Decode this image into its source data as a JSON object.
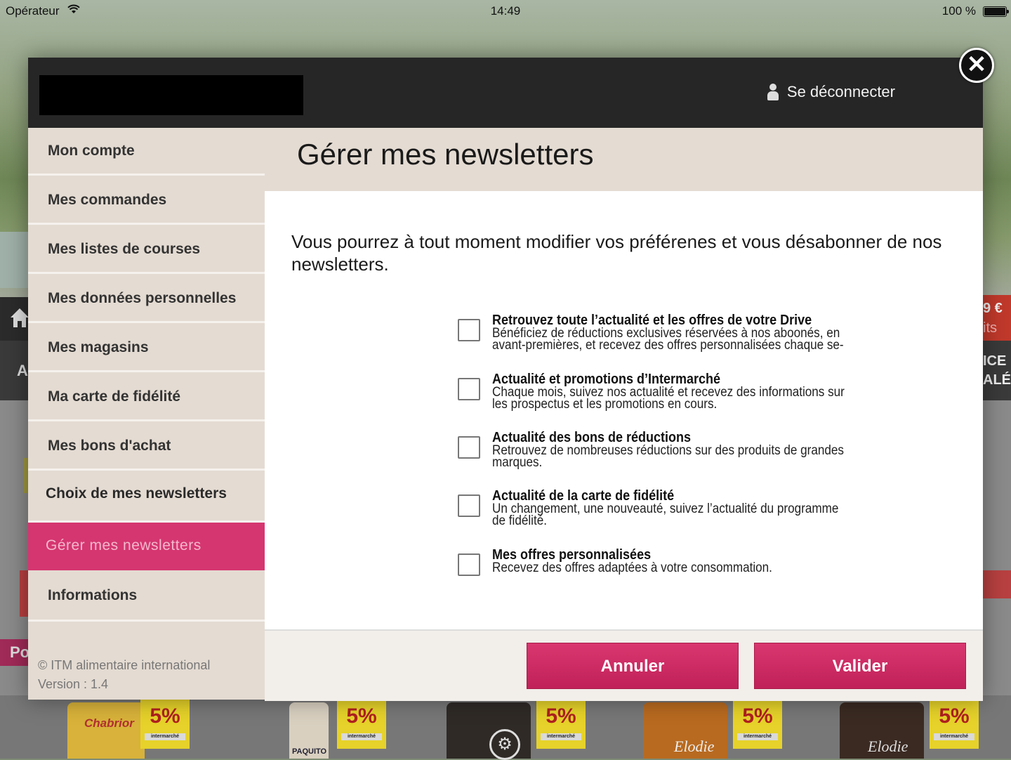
{
  "status_bar": {
    "carrier": "Opérateur",
    "time": "14:49",
    "battery": "100 %"
  },
  "background": {
    "price_fragment": "9 €",
    "text_fragment_1": "its",
    "text_fragment_2": "ICE",
    "text_fragment_3": "ALÉ",
    "letter_a": "A",
    "po_fragment": "Po",
    "promo_badge": "5%",
    "promo_caption": "intermarché",
    "brands": [
      "Chabrior",
      "PAQUITO",
      "",
      "Elodie",
      "Elodie"
    ]
  },
  "header": {
    "logout_label": "Se déconnecter"
  },
  "sidebar": {
    "items": [
      {
        "label": "Mon compte"
      },
      {
        "label": "Mes commandes"
      },
      {
        "label": "Mes listes de courses"
      },
      {
        "label": "Mes données personnelles"
      },
      {
        "label": "Mes magasins"
      },
      {
        "label": "Ma carte de fidélité"
      },
      {
        "label": "Mes bons d'achat"
      },
      {
        "label": "Choix de mes newsletters"
      },
      {
        "label": "Gérer mes newsletters"
      },
      {
        "label": "Informations"
      }
    ],
    "copyright": "© ITM alimentaire international",
    "version": "Version : 1.4"
  },
  "main": {
    "title": "Gérer mes newsletters",
    "intro": "Vous pourrez à tout moment modifier vos préférenes et vous désabonner de nos newsletters.",
    "options": [
      {
        "title": "Retrouvez toute l’actualité et les offres de votre Drive",
        "description": "Bénéficiez de réductions exclusives réservées à nos aboonés, en avant-premières, et recevez des offres personnalisées chaque se-"
      },
      {
        "title": "Actualité et promotions d’Intermarché",
        "description": "Chaque mois, suivez nos actualité et recevez des informations sur les prospectus et les promotions en cours."
      },
      {
        "title": "Actualité des bons de réductions",
        "description": "Retrouvez de nombreuses réductions sur des produits de grandes marques."
      },
      {
        "title": "Actualité de la carte de fidélité",
        "description": "Un changement, une nouveauté, suivez l’actualité du programme de fidélité."
      },
      {
        "title": "Mes offres personnalisées",
        "description": "Recevez des offres adaptées à votre consommation."
      }
    ]
  },
  "footer": {
    "cancel_label": "Annuler",
    "submit_label": "Valider"
  },
  "icons": {
    "close": "close-icon",
    "user": "user-icon",
    "home": "home-icon",
    "wifi": "wifi-icon",
    "battery": "battery-icon",
    "wrench": "wrench-icon"
  },
  "colors": {
    "accent": "#d53670",
    "header_bg": "#262626",
    "sidebar_bg": "#e4dbd2"
  }
}
